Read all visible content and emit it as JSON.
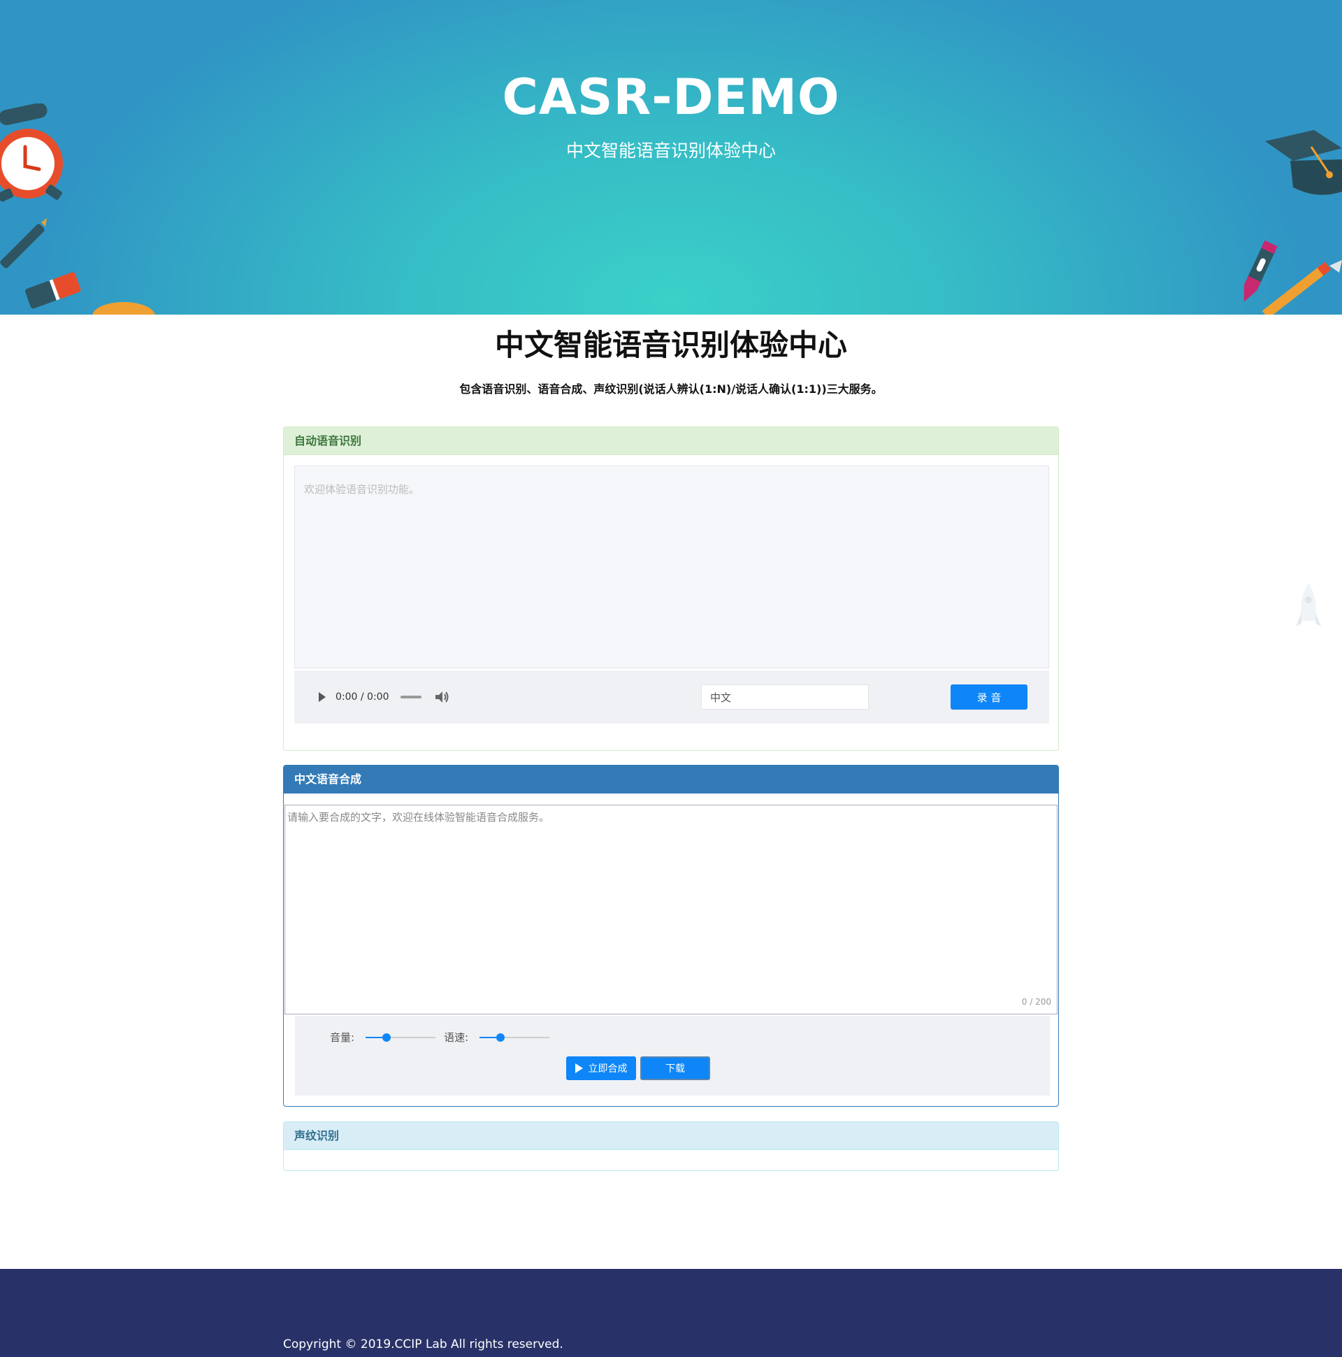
{
  "hero": {
    "title": "CASR-DEMO",
    "subtitle": "中文智能语音识别体验中心"
  },
  "page": {
    "title": "中文智能语音识别体验中心",
    "description": "包含语音识别、语音合成、声纹识别(说话人辨认(1:N)/说话人确认(1:1))三大服务。"
  },
  "asr": {
    "heading": "自动语音识别",
    "placeholder": "欢迎体验语音识别功能。",
    "audio_time": "0:00 / 0:00",
    "language_value": "中文",
    "record_label": "录 音"
  },
  "tts": {
    "heading": "中文语音合成",
    "placeholder": "请输入要合成的文字，欢迎在线体验智能语音合成服务。",
    "char_count": "0 / 200",
    "volume_label": "音量:",
    "volume_level": 0.3,
    "speed_label": "语速:",
    "speed_level": 0.3,
    "synth_label": "立即合成",
    "download_label": "下载"
  },
  "vpr": {
    "heading": "声纹识别"
  },
  "footer": {
    "copyright": "Copyright © 2019.CCIP Lab All rights reserved."
  },
  "colors": {
    "primary": "#0e86f8",
    "hero_teal": "#3bd0c8",
    "hero_blue": "#3095c4",
    "footer_bg": "#283268"
  },
  "icons": [
    "alarm-clock-icon",
    "pen-icon",
    "eraser-icon",
    "graduation-cap-icon",
    "crayon-icon",
    "pencil-icon",
    "rocket-icon",
    "play-icon",
    "volume-icon"
  ]
}
